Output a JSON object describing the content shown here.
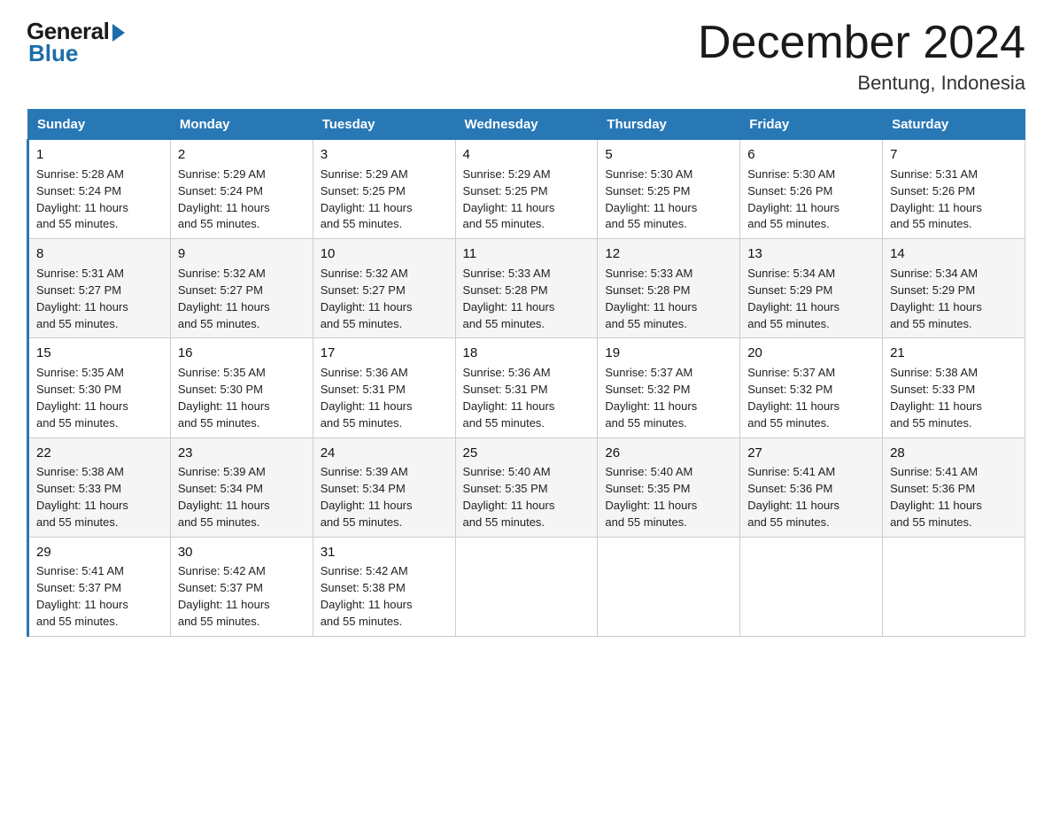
{
  "logo": {
    "general": "General",
    "blue": "Blue"
  },
  "title": "December 2024",
  "subtitle": "Bentung, Indonesia",
  "weekdays": [
    "Sunday",
    "Monday",
    "Tuesday",
    "Wednesday",
    "Thursday",
    "Friday",
    "Saturday"
  ],
  "weeks": [
    [
      {
        "day": "1",
        "sunrise": "5:28 AM",
        "sunset": "5:24 PM",
        "daylight": "11 hours and 55 minutes."
      },
      {
        "day": "2",
        "sunrise": "5:29 AM",
        "sunset": "5:24 PM",
        "daylight": "11 hours and 55 minutes."
      },
      {
        "day": "3",
        "sunrise": "5:29 AM",
        "sunset": "5:25 PM",
        "daylight": "11 hours and 55 minutes."
      },
      {
        "day": "4",
        "sunrise": "5:29 AM",
        "sunset": "5:25 PM",
        "daylight": "11 hours and 55 minutes."
      },
      {
        "day": "5",
        "sunrise": "5:30 AM",
        "sunset": "5:25 PM",
        "daylight": "11 hours and 55 minutes."
      },
      {
        "day": "6",
        "sunrise": "5:30 AM",
        "sunset": "5:26 PM",
        "daylight": "11 hours and 55 minutes."
      },
      {
        "day": "7",
        "sunrise": "5:31 AM",
        "sunset": "5:26 PM",
        "daylight": "11 hours and 55 minutes."
      }
    ],
    [
      {
        "day": "8",
        "sunrise": "5:31 AM",
        "sunset": "5:27 PM",
        "daylight": "11 hours and 55 minutes."
      },
      {
        "day": "9",
        "sunrise": "5:32 AM",
        "sunset": "5:27 PM",
        "daylight": "11 hours and 55 minutes."
      },
      {
        "day": "10",
        "sunrise": "5:32 AM",
        "sunset": "5:27 PM",
        "daylight": "11 hours and 55 minutes."
      },
      {
        "day": "11",
        "sunrise": "5:33 AM",
        "sunset": "5:28 PM",
        "daylight": "11 hours and 55 minutes."
      },
      {
        "day": "12",
        "sunrise": "5:33 AM",
        "sunset": "5:28 PM",
        "daylight": "11 hours and 55 minutes."
      },
      {
        "day": "13",
        "sunrise": "5:34 AM",
        "sunset": "5:29 PM",
        "daylight": "11 hours and 55 minutes."
      },
      {
        "day": "14",
        "sunrise": "5:34 AM",
        "sunset": "5:29 PM",
        "daylight": "11 hours and 55 minutes."
      }
    ],
    [
      {
        "day": "15",
        "sunrise": "5:35 AM",
        "sunset": "5:30 PM",
        "daylight": "11 hours and 55 minutes."
      },
      {
        "day": "16",
        "sunrise": "5:35 AM",
        "sunset": "5:30 PM",
        "daylight": "11 hours and 55 minutes."
      },
      {
        "day": "17",
        "sunrise": "5:36 AM",
        "sunset": "5:31 PM",
        "daylight": "11 hours and 55 minutes."
      },
      {
        "day": "18",
        "sunrise": "5:36 AM",
        "sunset": "5:31 PM",
        "daylight": "11 hours and 55 minutes."
      },
      {
        "day": "19",
        "sunrise": "5:37 AM",
        "sunset": "5:32 PM",
        "daylight": "11 hours and 55 minutes."
      },
      {
        "day": "20",
        "sunrise": "5:37 AM",
        "sunset": "5:32 PM",
        "daylight": "11 hours and 55 minutes."
      },
      {
        "day": "21",
        "sunrise": "5:38 AM",
        "sunset": "5:33 PM",
        "daylight": "11 hours and 55 minutes."
      }
    ],
    [
      {
        "day": "22",
        "sunrise": "5:38 AM",
        "sunset": "5:33 PM",
        "daylight": "11 hours and 55 minutes."
      },
      {
        "day": "23",
        "sunrise": "5:39 AM",
        "sunset": "5:34 PM",
        "daylight": "11 hours and 55 minutes."
      },
      {
        "day": "24",
        "sunrise": "5:39 AM",
        "sunset": "5:34 PM",
        "daylight": "11 hours and 55 minutes."
      },
      {
        "day": "25",
        "sunrise": "5:40 AM",
        "sunset": "5:35 PM",
        "daylight": "11 hours and 55 minutes."
      },
      {
        "day": "26",
        "sunrise": "5:40 AM",
        "sunset": "5:35 PM",
        "daylight": "11 hours and 55 minutes."
      },
      {
        "day": "27",
        "sunrise": "5:41 AM",
        "sunset": "5:36 PM",
        "daylight": "11 hours and 55 minutes."
      },
      {
        "day": "28",
        "sunrise": "5:41 AM",
        "sunset": "5:36 PM",
        "daylight": "11 hours and 55 minutes."
      }
    ],
    [
      {
        "day": "29",
        "sunrise": "5:41 AM",
        "sunset": "5:37 PM",
        "daylight": "11 hours and 55 minutes."
      },
      {
        "day": "30",
        "sunrise": "5:42 AM",
        "sunset": "5:37 PM",
        "daylight": "11 hours and 55 minutes."
      },
      {
        "day": "31",
        "sunrise": "5:42 AM",
        "sunset": "5:38 PM",
        "daylight": "11 hours and 55 minutes."
      },
      null,
      null,
      null,
      null
    ]
  ],
  "labels": {
    "sunrise": "Sunrise:",
    "sunset": "Sunset:",
    "daylight": "Daylight:"
  }
}
